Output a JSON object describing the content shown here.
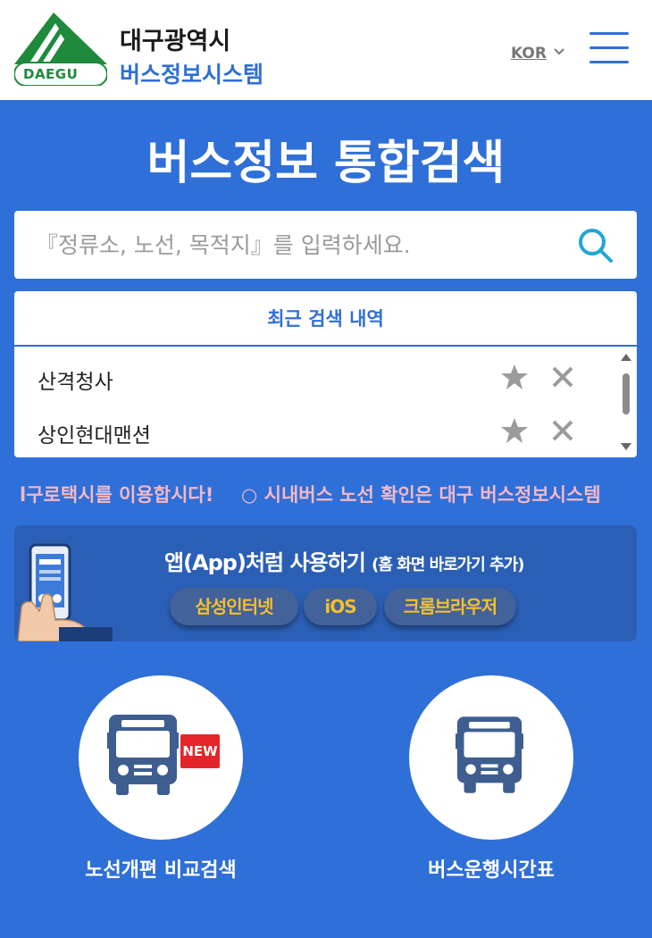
{
  "header": {
    "logo_text": "DAEGU",
    "brand_line1": "대구광역시",
    "brand_line2": "버스정보시스템",
    "language": "KOR",
    "menu_icon": "hamburger-icon"
  },
  "main": {
    "title": "버스정보 통합검색"
  },
  "search": {
    "placeholder": "『정류소, 노선, 목적지』를 입력하세요.",
    "icon": "search-icon"
  },
  "recent": {
    "header": "최근 검색 내역",
    "items": [
      {
        "label": "산격청사"
      },
      {
        "label": "상인현대맨션"
      }
    ]
  },
  "marquee": {
    "item1": "l구로택시를 이용합시다!",
    "item2": "○ 시내버스 노선 확인은 대구 버스정보시스템"
  },
  "app_banner": {
    "title": "앱(App)처럼 사용하기",
    "subtitle": "(홈 화면 바로가기 추가)",
    "buttons": [
      "삼성인터넷",
      "iOS",
      "크롬브라우저"
    ]
  },
  "shortcuts": [
    {
      "label": "노선개편 비교검색",
      "badge": "NEW",
      "icon": "bus-icon"
    },
    {
      "label": "버스운행시간표",
      "icon": "bus-icon"
    }
  ],
  "colors": {
    "primary": "#2f6fd8",
    "banner": "#2b5fb6",
    "pill_text": "#f3c02b",
    "badge": "#e4262b",
    "logo_green": "#1f8a3c"
  }
}
